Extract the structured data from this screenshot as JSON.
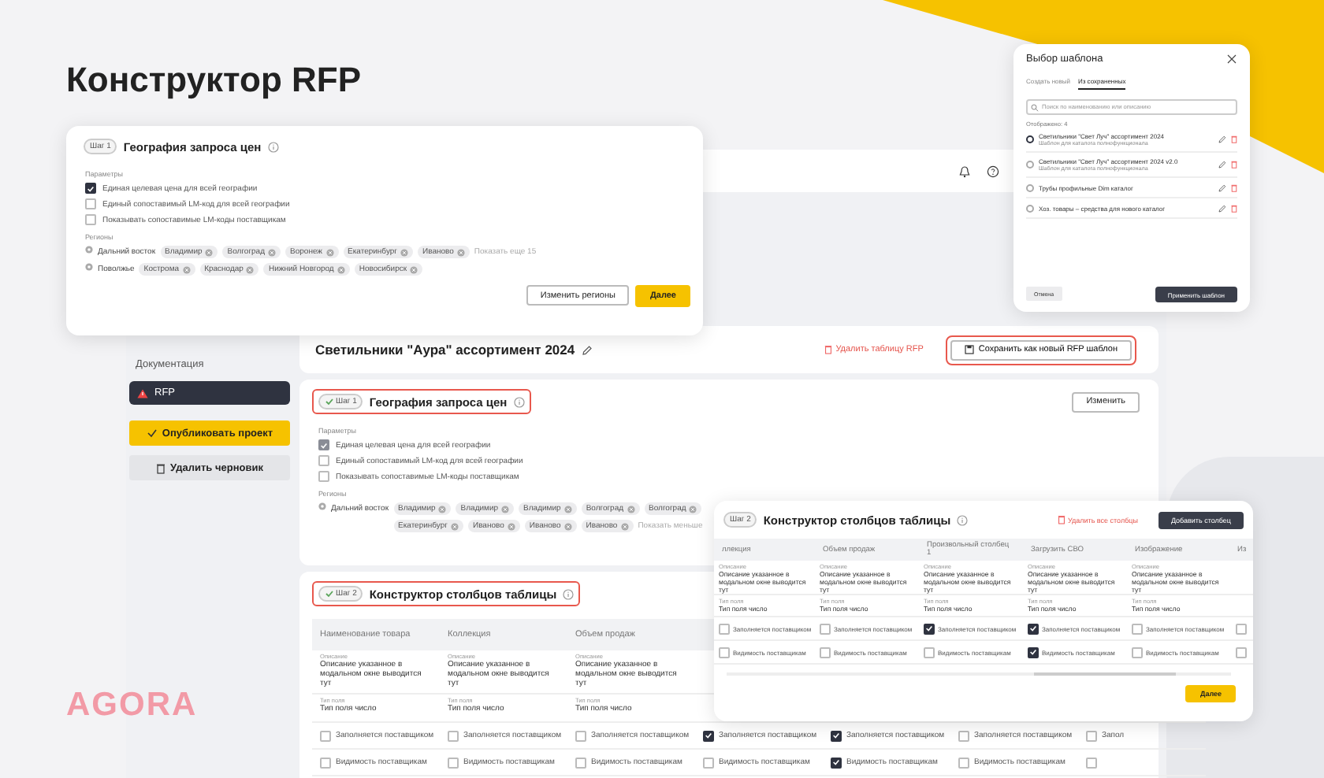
{
  "heading": "Конструктор RFP",
  "logo": "AGORA",
  "app": {
    "sidebar": {
      "items": [
        {
          "label": "Документация",
          "kind": "link",
          "selected": false
        },
        {
          "label": "RFP",
          "kind": "warning",
          "selected": true
        }
      ],
      "publish_button": "Опубликовать проект",
      "delete_button": "Удалить черновик"
    },
    "project": {
      "title": "Светильники \"Аура\" ассортимент 2024",
      "delete_link": "Удалить таблицу RFP",
      "save_button": "Сохранить как новый RFP шаблон",
      "highlighted": true
    },
    "step1": {
      "step": "Шаг 1",
      "done": true,
      "title": "География запроса цен",
      "highlighted": true,
      "action": "Изменить",
      "params_label": "Параметры",
      "options": [
        {
          "label": "Единая целевая цена для всей географии",
          "checked": true
        },
        {
          "label": "Единый сопоставимый LM-код для всей географии",
          "checked": false
        },
        {
          "label": "Показывать сопоставимые LM-коды поставщикам",
          "checked": false
        }
      ],
      "regions_label": "Регионы",
      "regions": [
        {
          "name": "Дальний восток",
          "cities": [
            "Владимир",
            "Владимир",
            "Владимир",
            "Волгоград",
            "Волгоград",
            "Екатеринбург",
            "Иваново",
            "Иваново",
            "Иваново"
          ],
          "more": "Показать меньше"
        }
      ]
    },
    "step2": {
      "step": "Шаг 2",
      "done": true,
      "title": "Конструктор столбцов таблицы",
      "highlighted": true,
      "columns": [
        {
          "title": "Наименование товара",
          "desc_label": "Описание",
          "desc": "Описание указанное в модальном окне выводится тут",
          "type_label": "Тип поля",
          "type": "Тип поля число",
          "fill": {
            "label": "Заполняется поставщиком",
            "checked": false
          },
          "vis": {
            "label": "Видимость поставщикам",
            "checked": false
          }
        },
        {
          "title": "Коллекция",
          "desc_label": "Описание",
          "desc": "Описание указанное в модальном окне выводится тут",
          "type_label": "Тип поля",
          "type": "Тип поля число",
          "fill": {
            "label": "Заполняется поставщиком",
            "checked": false
          },
          "vis": {
            "label": "Видимость поставщикам",
            "checked": false
          }
        },
        {
          "title": "Объем продаж",
          "desc_label": "Описание",
          "desc": "Описание указанное в модальном окне выводится тут",
          "type_label": "Тип поля",
          "type": "Тип поля число",
          "fill": {
            "label": "Заполняется поставщиком",
            "checked": false
          },
          "vis": {
            "label": "Видимость поставщикам",
            "checked": false
          }
        },
        {
          "fill": {
            "label": "Заполняется поставщиком",
            "checked": true
          },
          "vis": {
            "label": "Видимость поставщикам",
            "checked": false
          }
        },
        {
          "fill": {
            "label": "Заполняется поставщиком",
            "checked": true
          },
          "vis": {
            "label": "Видимость поставщикам",
            "checked": true
          }
        },
        {
          "fill": {
            "label": "Заполняется поставщиком",
            "checked": false
          },
          "vis": {
            "label": "Видимость поставщикам",
            "checked": false
          }
        },
        {
          "fill": {
            "label": "Запол",
            "checked": false
          },
          "vis": {
            "checked": false
          }
        }
      ]
    }
  },
  "geography_dialog": {
    "step": "Шаг 1",
    "title": "География запроса цен",
    "params_label": "Параметры",
    "options": [
      {
        "label": "Единая целевая цена для всей географии",
        "checked": true
      },
      {
        "label": "Единый сопоставимый LM-код для всей географии",
        "checked": false
      },
      {
        "label": "Показывать сопоставимые LM-коды поставщикам",
        "checked": false
      }
    ],
    "regions_label": "Регионы",
    "regions": [
      {
        "name": "Дальний восток",
        "cities": [
          "Владимир",
          "Волгоград",
          "Воронеж",
          "Екатеринбург",
          "Иваново"
        ],
        "more": "Показать еще 15"
      },
      {
        "name": "Поволжье",
        "cities": [
          "Кострома",
          "Краснодар",
          "Нижний Новгород",
          "Новосибирск"
        ]
      }
    ],
    "secondary_button": "Изменить регионы",
    "primary_button": "Далее"
  },
  "template_dialog": {
    "title": "Выбор шаблона",
    "tabs": [
      {
        "label": "Создать новый",
        "selected": false
      },
      {
        "label": "Из сохраненных",
        "selected": true
      }
    ],
    "search": {
      "placeholder": "Поиск по наименованию или описанию"
    },
    "count": "Отображено: 4",
    "templates": [
      {
        "name": "Светильники \"Свет Луч\" ассортимент 2024",
        "note": "Шаблон для каталога полнофункционала",
        "selected": true
      },
      {
        "name": "Светильники \"Свет Луч\" ассортимент 2024 v2.0",
        "note": "Шаблон для каталога полнофункционала",
        "selected": false
      },
      {
        "name": "Трубы профильные Dim каталог",
        "selected": false
      },
      {
        "name": "Хоз. товары – средства для нового каталог",
        "selected": false
      }
    ],
    "cancel_button": "Отмена",
    "apply_button": "Применить шаблон"
  },
  "columns_dialog": {
    "step": "Шаг 2",
    "title": "Конструктор столбцов таблицы",
    "delete_link": "Удалить все столбцы",
    "add_button": "Добавить столбец",
    "columns": [
      {
        "title": "ллекция",
        "desc_label": "Описание",
        "desc": "Описание указанное в модальном окне выводится тут",
        "type_label": "Тип поля",
        "type": "Тип поля число",
        "fill": {
          "label": "Заполняется поставщиком",
          "checked": false
        },
        "vis": {
          "label": "Видимость поставщикам",
          "checked": false
        }
      },
      {
        "title": "Объем продаж",
        "desc_label": "Описание",
        "desc": "Описание указанное в модальном окне выводится тут",
        "type_label": "Тип поля",
        "type": "Тип поля число",
        "fill": {
          "label": "Заполняется поставщиком",
          "checked": false
        },
        "vis": {
          "label": "Видимость поставщикам",
          "checked": false
        }
      },
      {
        "title": "Произвольный столбец 1",
        "desc_label": "Описание",
        "desc": "Описание указанное в модальном окне выводится тут",
        "type_label": "Тип поля",
        "type": "Тип поля число",
        "fill": {
          "label": "Заполняется поставщиком",
          "checked": true
        },
        "vis": {
          "label": "Видимость поставщикам",
          "checked": false
        }
      },
      {
        "title": "Загрузить СВО",
        "desc_label": "Описание",
        "desc": "Описание указанное в модальном окне выводится тут",
        "type_label": "Тип поля",
        "type": "Тип поля число",
        "fill": {
          "label": "Заполняется поставщиком",
          "checked": true
        },
        "vis": {
          "label": "Видимость поставщикам",
          "checked": true
        }
      },
      {
        "title": "Изображение",
        "desc_label": "Описание",
        "desc": "Описание указанное в модальном окне выводится тут",
        "type_label": "Тип поля",
        "type": "Тип поля число",
        "fill": {
          "label": "Заполняется поставщиком",
          "checked": false
        },
        "vis": {
          "label": "Видимость поставщикам",
          "checked": false
        }
      },
      {
        "title": "Из",
        "fill": {
          "checked": false
        },
        "vis": {
          "checked": false
        }
      }
    ],
    "next_button": "Далее"
  }
}
